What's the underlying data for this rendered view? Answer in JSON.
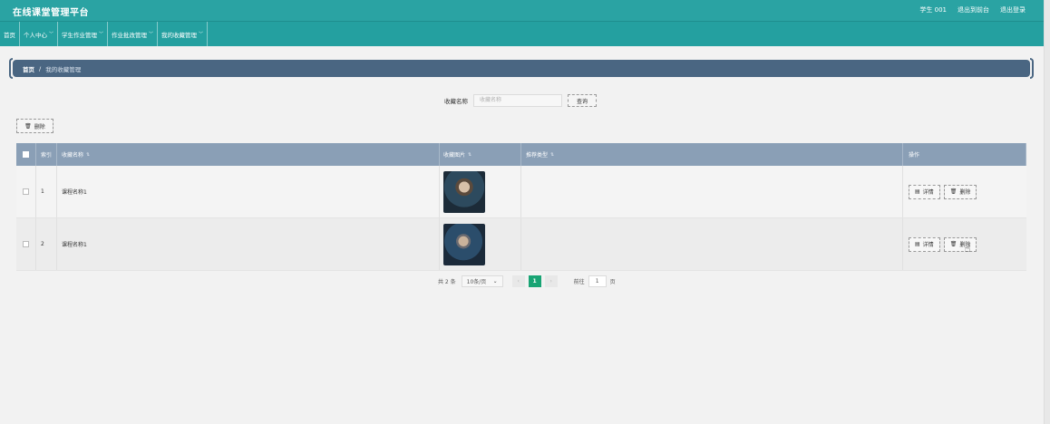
{
  "header": {
    "title": "在线课堂管理平台",
    "user": "学生 001",
    "back_front": "退出到前台",
    "logout": "退出登录"
  },
  "nav": [
    {
      "label": "首页",
      "has_menu": false
    },
    {
      "label": "个人中心",
      "has_menu": true
    },
    {
      "label": "学生作业管理",
      "has_menu": true
    },
    {
      "label": "作业批改管理",
      "has_menu": true
    },
    {
      "label": "我的收藏管理",
      "has_menu": true
    }
  ],
  "breadcrumb": {
    "home": "首页",
    "sep": "/",
    "current": "我的收藏管理"
  },
  "search": {
    "label": "收藏名称",
    "placeholder": "收藏名称",
    "button": "查询"
  },
  "toolbar": {
    "delete_label": "删除"
  },
  "table": {
    "headers": {
      "index": "索引",
      "name": "收藏名称",
      "image": "收藏图片",
      "type": "推荐类型",
      "ops": "操作"
    },
    "rows": [
      {
        "index": "1",
        "name": "课程名称1",
        "type": ""
      },
      {
        "index": "2",
        "name": "课程名称1",
        "type": ""
      }
    ],
    "detail_label": "详情",
    "delete_label": "删除"
  },
  "pagination": {
    "total": "共 2 条",
    "page_size": "10条/页",
    "current_page": "1",
    "goto_prefix": "前往",
    "goto_value": "1",
    "goto_suffix": "页"
  },
  "icons": {
    "sort": "sort-icon",
    "chevron": "chevron-down-icon",
    "delete": "trash-icon",
    "detail": "document-icon"
  },
  "colors": {
    "topbar": "#2aa3a3",
    "breadcrumb": "#4a6682",
    "table_header": "#8a9fb6",
    "page_active": "#19a474"
  }
}
